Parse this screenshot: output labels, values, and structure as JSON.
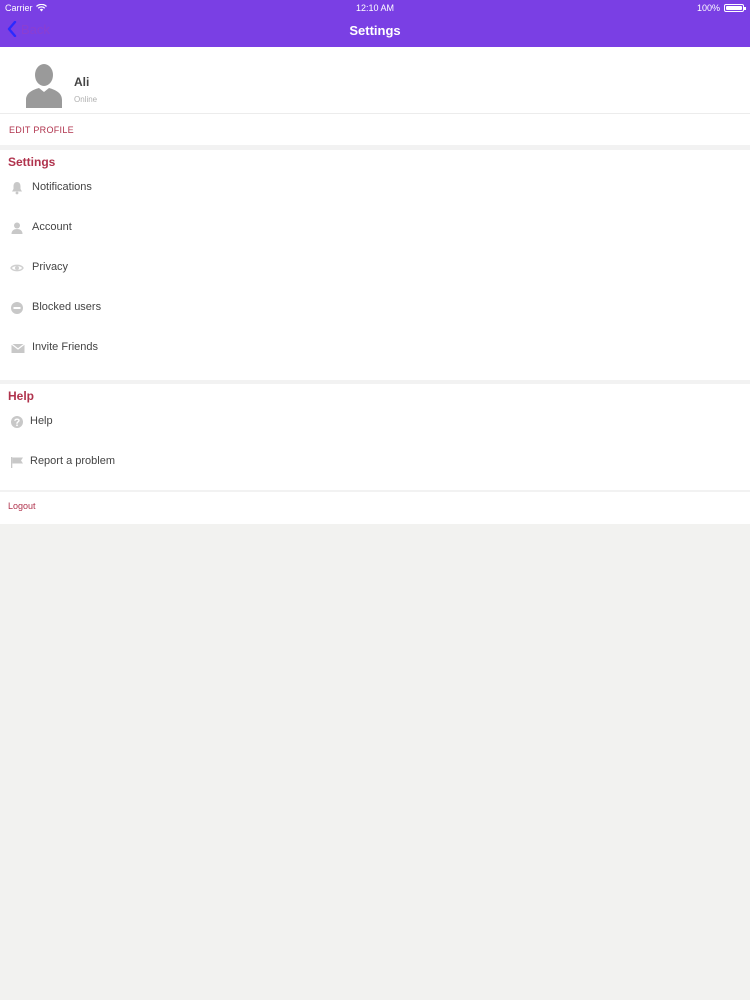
{
  "status_bar": {
    "carrier": "Carrier",
    "time": "12:10 AM",
    "battery": "100%"
  },
  "nav": {
    "back_label": "Back",
    "title": "Settings"
  },
  "profile": {
    "name": "Ali",
    "status": "Online",
    "edit_label": "EDIT PROFILE"
  },
  "settings_section": {
    "title": "Settings",
    "items": [
      {
        "label": "Notifications",
        "icon": "bell-icon"
      },
      {
        "label": "Account",
        "icon": "person-icon"
      },
      {
        "label": "Privacy",
        "icon": "eye-icon"
      },
      {
        "label": "Blocked users",
        "icon": "blocked-icon"
      },
      {
        "label": "Invite Friends",
        "icon": "envelope-icon"
      }
    ]
  },
  "help_section": {
    "title": "Help",
    "items": [
      {
        "label": "Help",
        "icon": "question-icon"
      },
      {
        "label": "Report a problem",
        "icon": "flag-icon"
      }
    ]
  },
  "logout_label": "Logout",
  "colors": {
    "nav_bg": "#7a3fe4",
    "accent": "#b0334d",
    "icon_gray": "#c8c8c8"
  }
}
